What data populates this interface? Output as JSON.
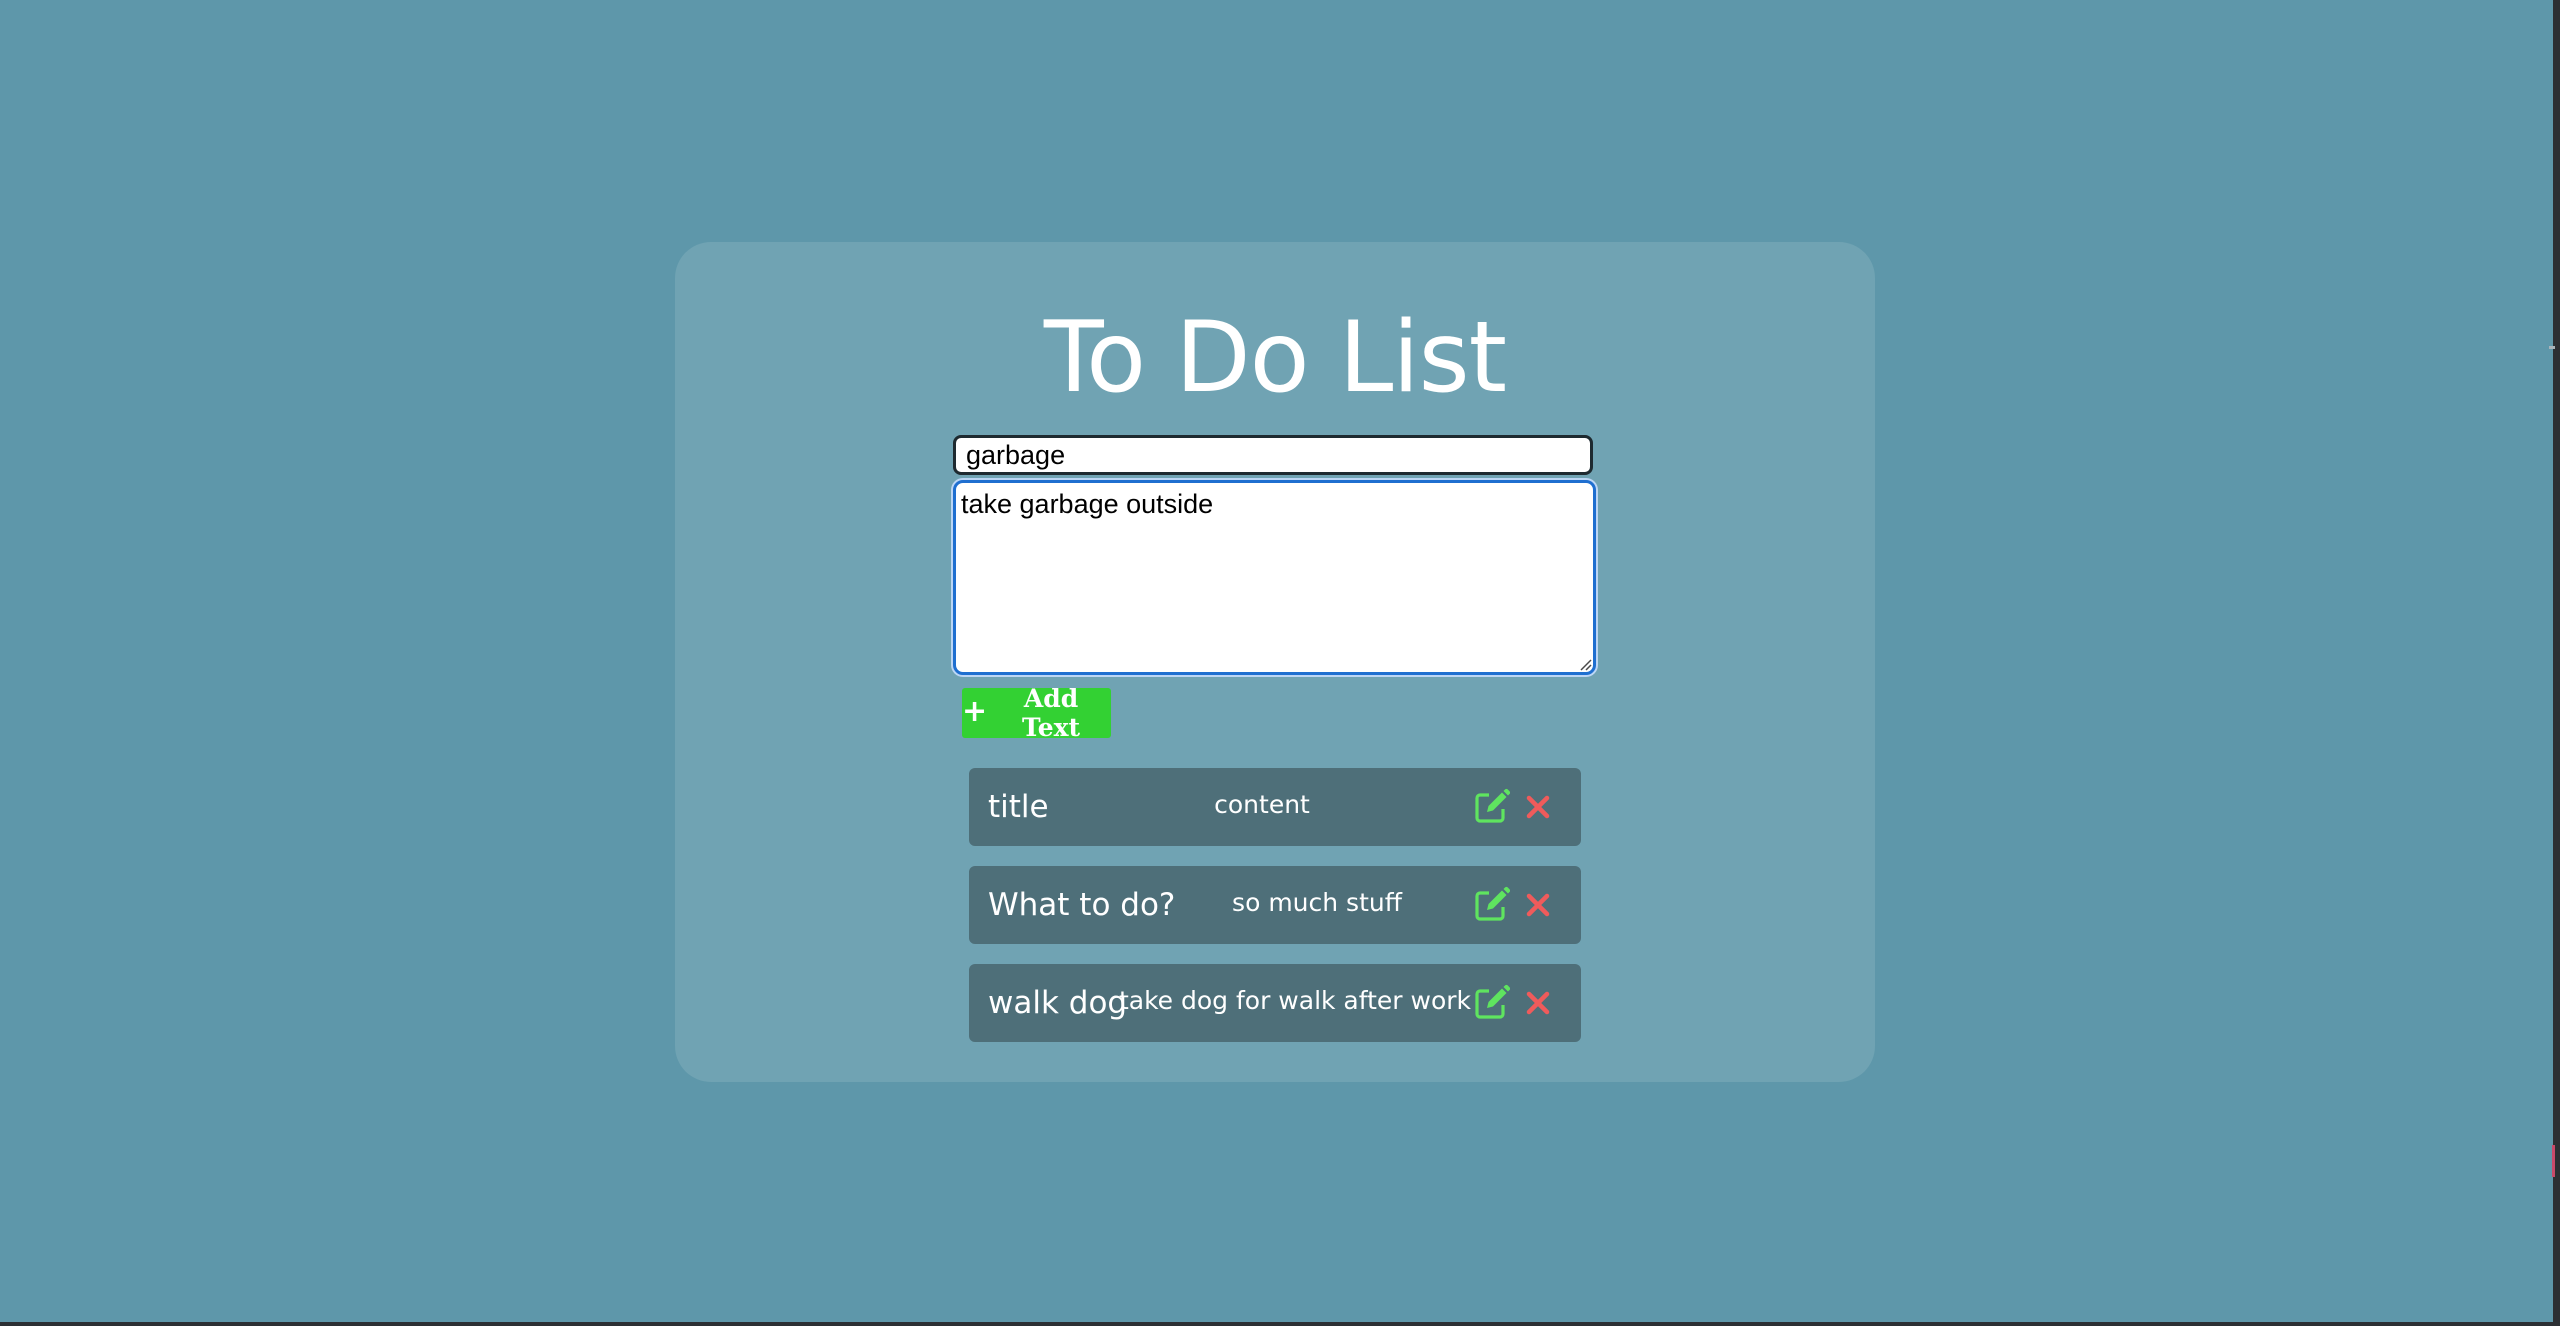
{
  "app": {
    "title": "To Do List"
  },
  "form": {
    "title_input_value": "garbage",
    "content_textarea_value": "take garbage outside",
    "add_button_label": "Add Text",
    "add_button_icon": "plus-icon"
  },
  "todos": [
    {
      "title": "title",
      "content": "content"
    },
    {
      "title": "What to do?",
      "content": "so much stuff"
    },
    {
      "title": "walk dog",
      "content": "take dog for walk after work"
    }
  ],
  "icons": {
    "edit": "edit-icon",
    "delete": "close-icon"
  },
  "colors": {
    "background": "#5e97aa",
    "card": "#70a3b3",
    "item": "#4e6f79",
    "add_button": "#33d133",
    "edit_icon": "#5fe45f",
    "delete_icon": "#ef5b5b"
  }
}
